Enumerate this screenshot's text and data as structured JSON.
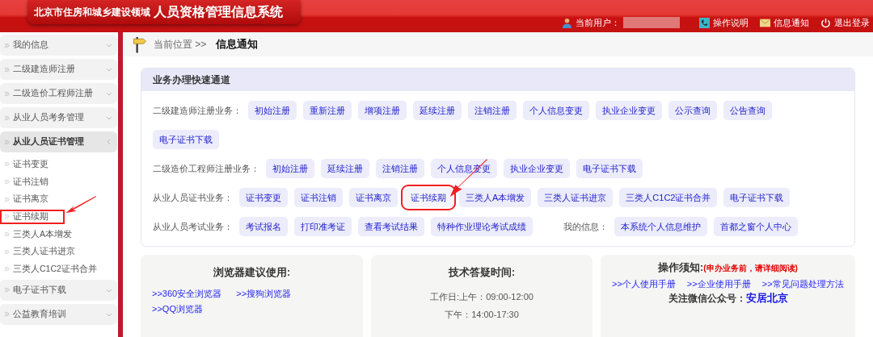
{
  "header": {
    "title_small": "北京市住房和城乡建设领域",
    "title_large": "人员资格管理信息系统",
    "user_label": "当前用户：",
    "links": [
      {
        "label": "操作说明",
        "kind": "help"
      },
      {
        "label": "信息通知",
        "kind": "mail"
      },
      {
        "label": "退出登录",
        "kind": "power"
      }
    ]
  },
  "sidebar": {
    "items": [
      {
        "label": "我的信息",
        "expanded": false
      },
      {
        "label": "二级建造师注册",
        "expanded": false
      },
      {
        "label": "二级造价工程师注册",
        "expanded": false
      },
      {
        "label": "从业人员考务管理",
        "expanded": false
      },
      {
        "label": "从业人员证书管理",
        "expanded": true,
        "children": [
          {
            "label": "证书变更",
            "annotated": false
          },
          {
            "label": "证书注销",
            "annotated": false
          },
          {
            "label": "证书离京",
            "annotated": false
          },
          {
            "label": "证书续期",
            "annotated": true
          },
          {
            "label": "三类人A本增发",
            "annotated": false
          },
          {
            "label": "三类人证书进京",
            "annotated": false
          },
          {
            "label": "三类人C1C2证书合并",
            "annotated": false
          }
        ]
      },
      {
        "label": "电子证书下载",
        "expanded": false
      },
      {
        "label": "公益教育培训",
        "expanded": false
      }
    ]
  },
  "breadcrumb": {
    "label": "当前位置 >>",
    "current": "信息通知"
  },
  "quick_panel": {
    "title": "业务办理快速通道",
    "rows": [
      {
        "groups": [
          {
            "label": "二级建造师注册业务：",
            "buttons": [
              {
                "label": "初始注册",
                "annotated": false
              },
              {
                "label": "重新注册",
                "annotated": false
              },
              {
                "label": "增项注册",
                "annotated": false
              },
              {
                "label": "延续注册",
                "annotated": false
              },
              {
                "label": "注销注册",
                "annotated": false
              },
              {
                "label": "个人信息变更",
                "annotated": false
              },
              {
                "label": "执业企业变更",
                "annotated": false
              },
              {
                "label": "公示查询",
                "annotated": false
              },
              {
                "label": "公告查询",
                "annotated": false
              },
              {
                "label": "电子证书下载",
                "annotated": false
              }
            ]
          }
        ]
      },
      {
        "groups": [
          {
            "label": "二级造价工程师注册业务：",
            "buttons": [
              {
                "label": "初始注册",
                "annotated": false
              },
              {
                "label": "延续注册",
                "annotated": false
              },
              {
                "label": "注销注册",
                "annotated": false
              },
              {
                "label": "个人信息变更",
                "annotated": false
              },
              {
                "label": "执业企业变更",
                "annotated": false
              },
              {
                "label": "电子证书下载",
                "annotated": false
              }
            ]
          }
        ]
      },
      {
        "groups": [
          {
            "label": "从业人员证书业务：",
            "buttons": [
              {
                "label": "证书变更",
                "annotated": false
              },
              {
                "label": "证书注销",
                "annotated": false
              },
              {
                "label": "证书离京",
                "annotated": false
              },
              {
                "label": "证书续期",
                "annotated": true
              },
              {
                "label": "三类人A本增发",
                "annotated": false
              },
              {
                "label": "三类人证书进京",
                "annotated": false
              },
              {
                "label": "三类人C1C2证书合并",
                "annotated": false
              },
              {
                "label": "电子证书下载",
                "annotated": false
              }
            ]
          }
        ]
      },
      {
        "groups": [
          {
            "label": "从业人员考试业务：",
            "buttons": [
              {
                "label": "考试报名",
                "annotated": false
              },
              {
                "label": "打印准考证",
                "annotated": false
              },
              {
                "label": "查看考试结果",
                "annotated": false
              },
              {
                "label": "特种作业理论考试成绩",
                "annotated": false
              }
            ]
          },
          {
            "label": "我的信息：",
            "buttons": [
              {
                "label": "本系统个人信息维护",
                "annotated": false
              },
              {
                "label": "首都之窗个人中心",
                "annotated": false
              }
            ]
          }
        ]
      }
    ]
  },
  "cards": [
    {
      "kind": "links",
      "title": "浏览器建议使用:",
      "links": [
        ">>360安全浏览器",
        ">>搜狗浏览器",
        ">>QQ浏览器"
      ]
    },
    {
      "kind": "hours",
      "title": "技术答疑时间:",
      "lines": [
        "工作日:上午：09:00-12:00",
        "下午：14:00-17:30"
      ]
    },
    {
      "kind": "notice",
      "title": "操作须知:",
      "note": "(申办业务前，请详细阅读)",
      "links": [
        ">>个人使用手册",
        ">>企业使用手册",
        ">>常见问题处理方法"
      ],
      "footer_label": "关注微信公众号：",
      "footer_link": "安居北京"
    }
  ]
}
